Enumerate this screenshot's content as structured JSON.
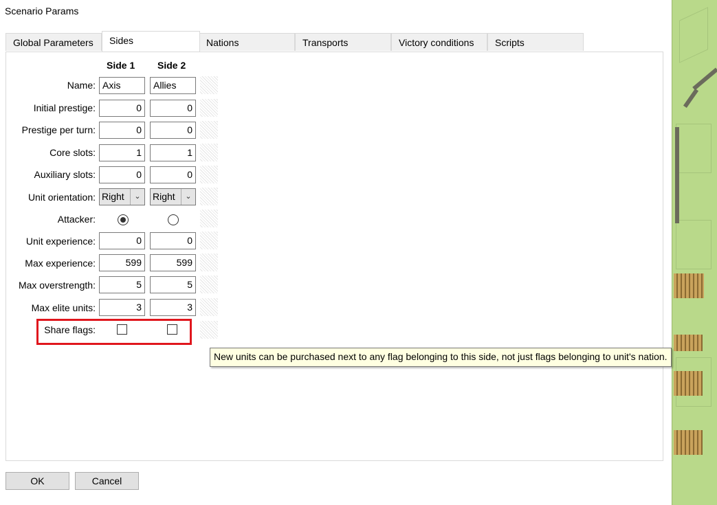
{
  "window": {
    "title": "Scenario Params"
  },
  "tabs": [
    {
      "label": "Global Parameters"
    },
    {
      "label": "Sides"
    },
    {
      "label": "Nations"
    },
    {
      "label": "Transports"
    },
    {
      "label": "Victory conditions"
    },
    {
      "label": "Scripts"
    }
  ],
  "active_tab": "Sides",
  "columns": {
    "side1": "Side 1",
    "side2": "Side 2"
  },
  "rows": {
    "name": {
      "label": "Name:",
      "side1": "Axis",
      "side2": "Allies"
    },
    "initial_prestige": {
      "label": "Initial prestige:",
      "side1": "0",
      "side2": "0"
    },
    "prestige_per_turn": {
      "label": "Prestige per turn:",
      "side1": "0",
      "side2": "0"
    },
    "core_slots": {
      "label": "Core slots:",
      "side1": "1",
      "side2": "1"
    },
    "auxiliary_slots": {
      "label": "Auxiliary slots:",
      "side1": "0",
      "side2": "0"
    },
    "unit_orientation": {
      "label": "Unit orientation:",
      "side1": "Right",
      "side2": "Right"
    },
    "attacker": {
      "label": "Attacker:",
      "selected": "side1"
    },
    "unit_experience": {
      "label": "Unit experience:",
      "side1": "0",
      "side2": "0"
    },
    "max_experience": {
      "label": "Max experience:",
      "side1": "599",
      "side2": "599"
    },
    "max_overstrength": {
      "label": "Max overstrength:",
      "side1": "5",
      "side2": "5"
    },
    "max_elite_units": {
      "label": "Max elite units:",
      "side1": "3",
      "side2": "3"
    },
    "share_flags": {
      "label": "Share flags:",
      "side1": false,
      "side2": false
    }
  },
  "tooltip": {
    "text": "New units can be purchased next to any flag belonging to this side, not just flags belonging to unit's nation."
  },
  "buttons": {
    "ok": "OK",
    "cancel": "Cancel"
  },
  "colors": {
    "highlight": "#e0161d",
    "tooltip_bg": "#ffffe1",
    "map_grass": "#b9d98a"
  }
}
